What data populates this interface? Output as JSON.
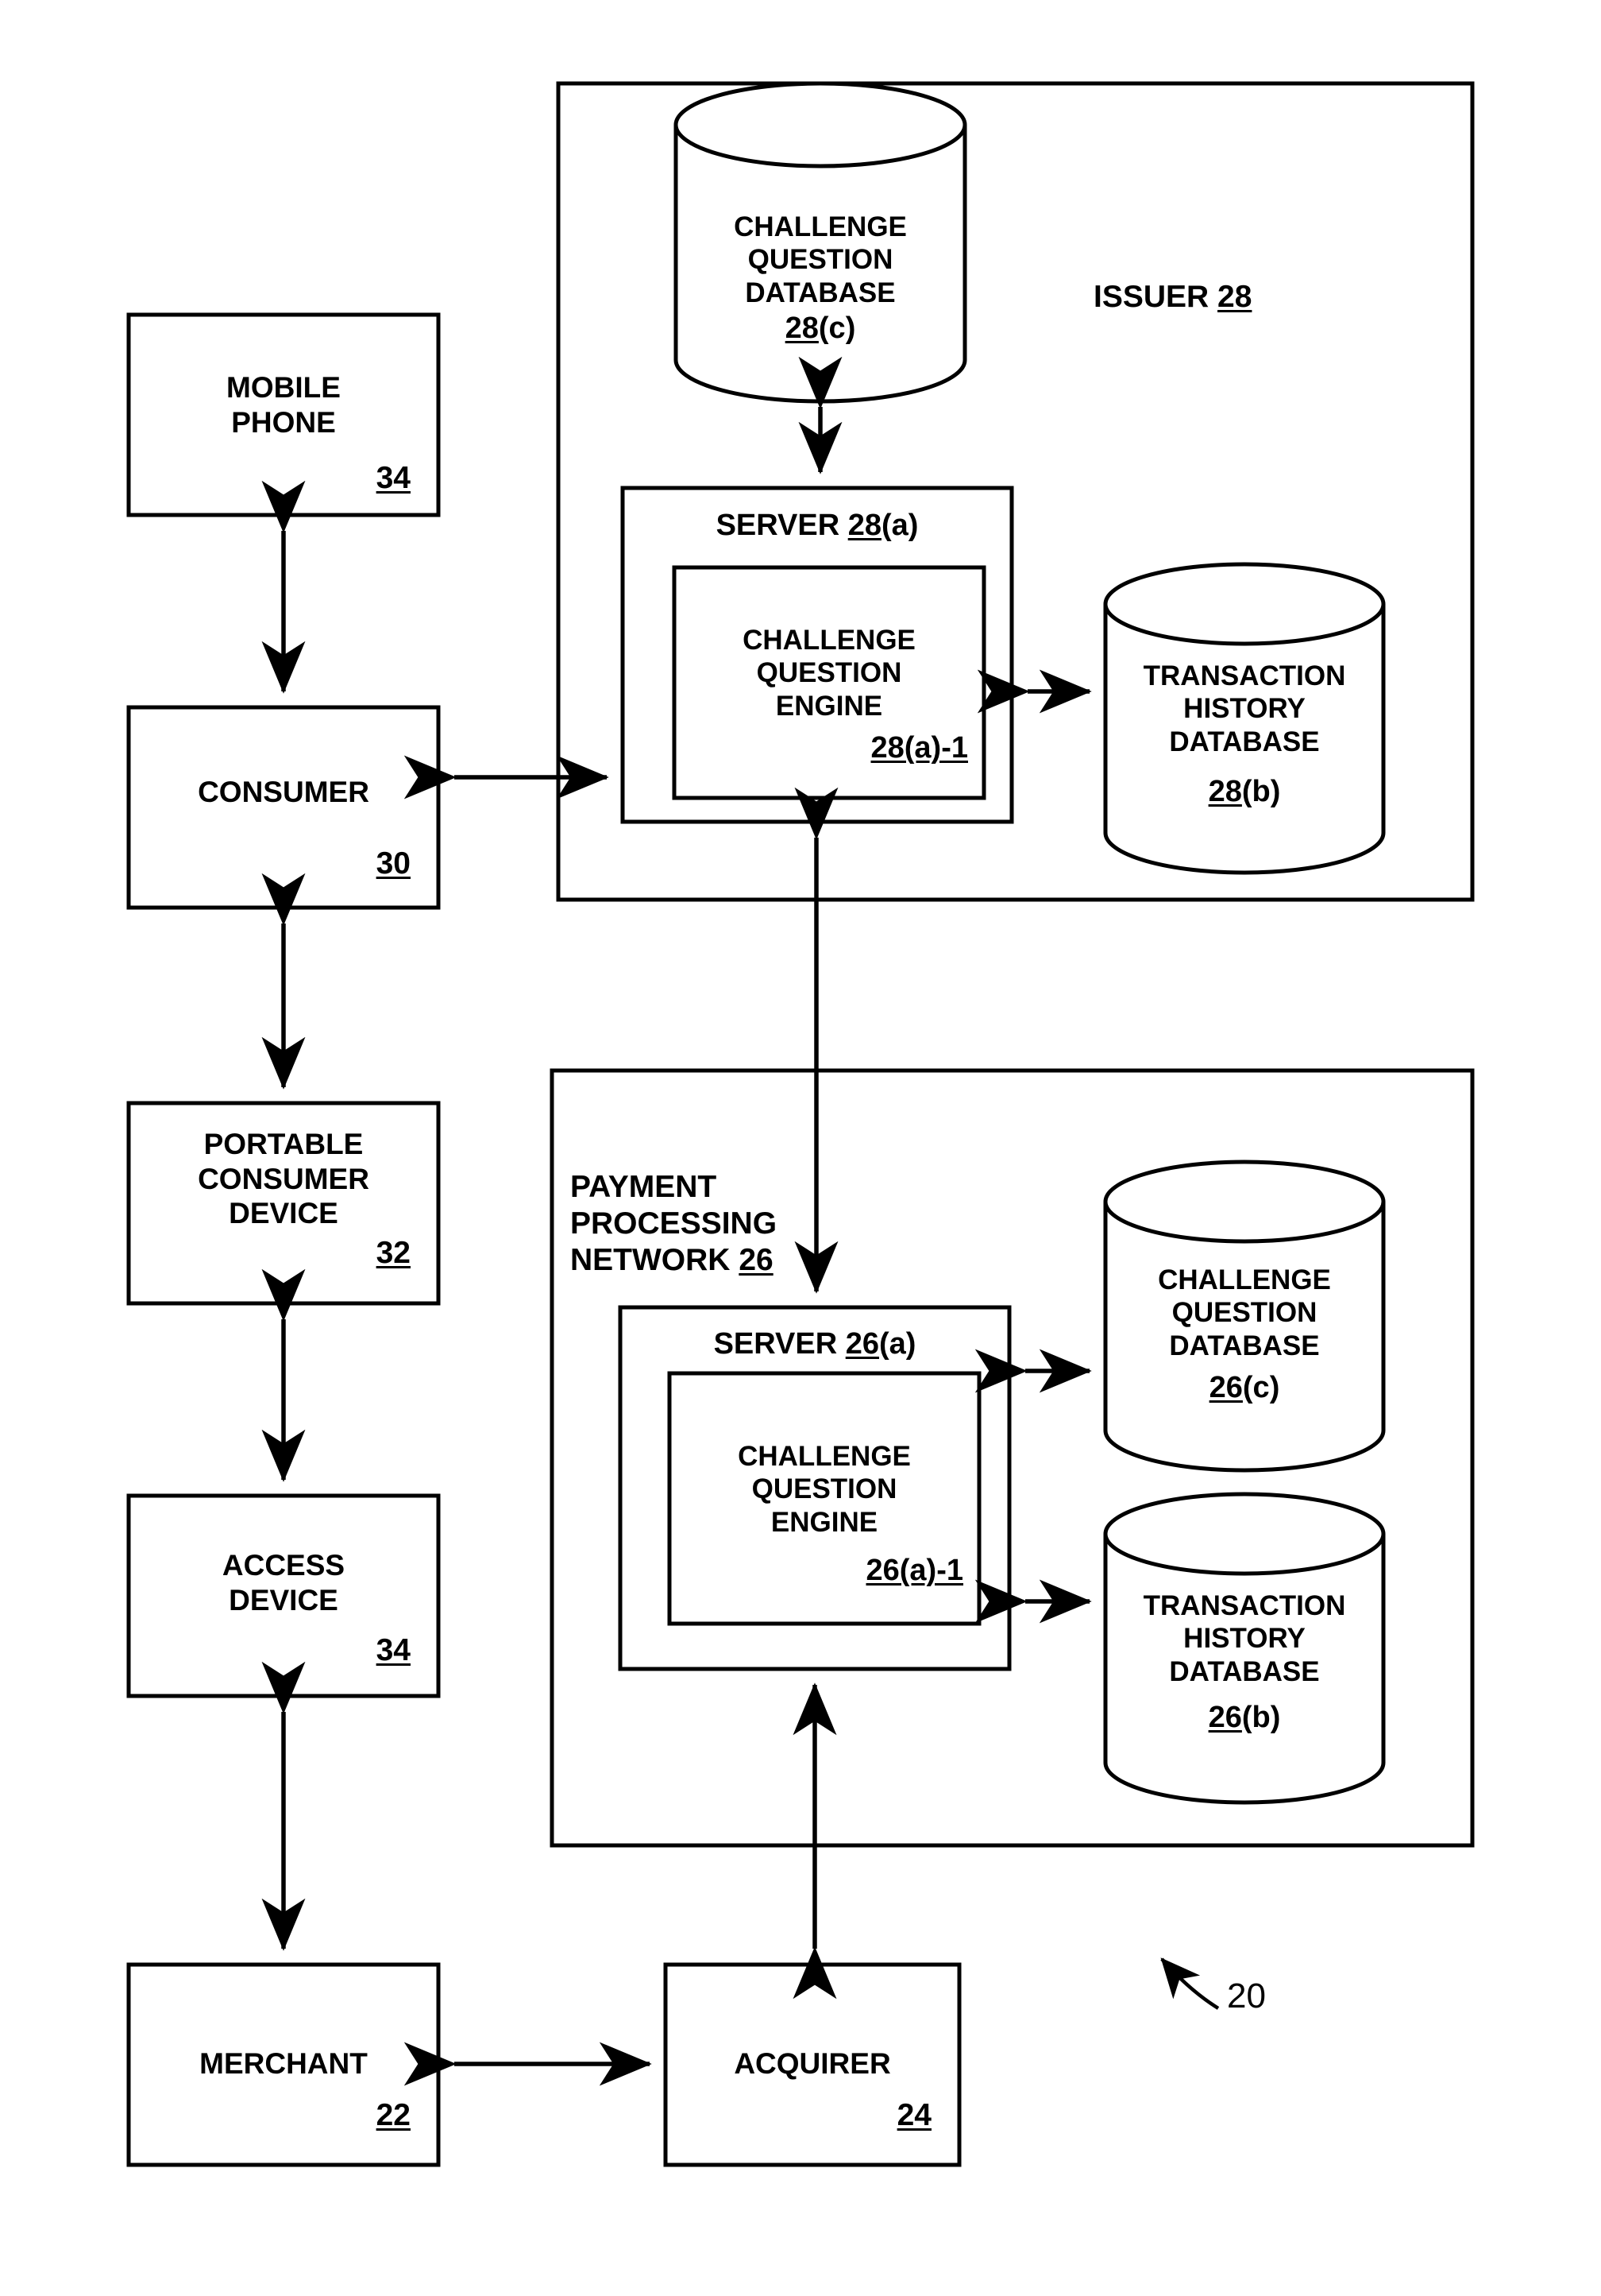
{
  "figure": {
    "reference_numeral": "20",
    "leader_label": "20"
  },
  "left_column": {
    "nodes": [
      {
        "name": "mobile-phone",
        "label": "MOBILE\nPHONE",
        "ref": "34"
      },
      {
        "name": "consumer",
        "label": "CONSUMER",
        "ref": "30"
      },
      {
        "name": "portable-consumer-device",
        "label": "PORTABLE\nCONSUMER\nDEVICE",
        "ref": "32"
      },
      {
        "name": "access-device",
        "label": "ACCESS\nDEVICE",
        "ref": "34"
      },
      {
        "name": "merchant",
        "label": "MERCHANT",
        "ref": "22"
      }
    ]
  },
  "bottom": {
    "acquirer": {
      "label": "ACQUIRER",
      "ref": "24"
    }
  },
  "issuer": {
    "title_text": "ISSUER ",
    "title_ref": "28",
    "challenge_question_database": {
      "label": "CHALLENGE\nQUESTION\nDATABASE",
      "ref_underlined": "28",
      "ref_plain": "(c)"
    },
    "server": {
      "label": "SERVER  ",
      "ref_underlined": "28",
      "ref_plain": "(a)",
      "engine": {
        "label": "CHALLENGE\nQUESTION\nENGINE",
        "ref": "28(a)-1"
      }
    },
    "transaction_history_database": {
      "label": "TRANSACTION\nHISTORY\nDATABASE",
      "ref_underlined": "28",
      "ref_plain": "(b)"
    }
  },
  "payment_processing_network": {
    "title": "PAYMENT\nPROCESSING\nNETWORK ",
    "title_ref": "26",
    "server": {
      "label": "SERVER  ",
      "ref_underlined": "26",
      "ref_plain": "(a)",
      "engine": {
        "label": "CHALLENGE\nQUESTION\nENGINE",
        "ref": "26(a)-1"
      }
    },
    "challenge_question_database": {
      "label": "CHALLENGE\nQUESTION\nDATABASE",
      "ref_underlined": "26",
      "ref_plain": "(c)"
    },
    "transaction_history_database": {
      "label": "TRANSACTION\nHISTORY\nDATABASE",
      "ref_underlined": "26",
      "ref_plain": "(b)"
    }
  },
  "colors": {
    "stroke": "#000000",
    "background": "#ffffff"
  }
}
